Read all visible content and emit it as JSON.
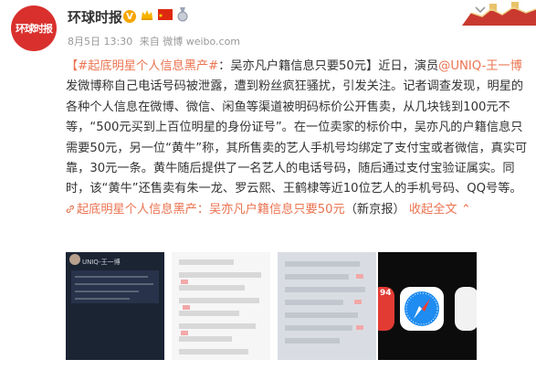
{
  "header": {
    "avatar_text": "环球时报",
    "account_name": "环球时报",
    "verified_badge": "V",
    "date": "8月5日 13:30",
    "source": "来自 微博 weibo.com"
  },
  "post": {
    "topic": "【#起底明星个人信息黑产#",
    "intro": "：吴亦凡户籍信息只要50元】近日，演员",
    "mention": "@UNIQ-王一博",
    "text": " 发微博称自己电话号码被泄露，遭到粉丝疯狂骚扰，引发关注。记者调查发现，明星的各种个人信息在微博、微信、闲鱼等渠道被明码标价公开售卖，从几块钱到100元不等，“500元买到上百位明星的身份证号”。在一位卖家的标价中，吴亦凡的户籍信息只需要50元，另一位“黄牛”称，其所售卖的艺人手机号均绑定了支付宝或者微信，真实可靠，30元一条。黄牛随后提供了一名艺人的电话号码，随后通过支付宝验证属实。同时，该“黄牛”还售卖有朱一龙、罗云熙、王鹤棣等近10位艺人的手机号码、QQ号等。",
    "link_text": "起底明星个人信息黑产：吴亦凡户籍信息只要50元",
    "suffix": "（新京报）",
    "expand": "收起全文",
    "expand_arrow": "⌃"
  },
  "images": {
    "img1_label": "UNIQ-王一博",
    "img4_badge": "94"
  },
  "colors": {
    "link": "#eb7350",
    "text": "#333333",
    "meta": "#999999",
    "brand_red": "#d9302d",
    "verified": "#f7a600"
  }
}
